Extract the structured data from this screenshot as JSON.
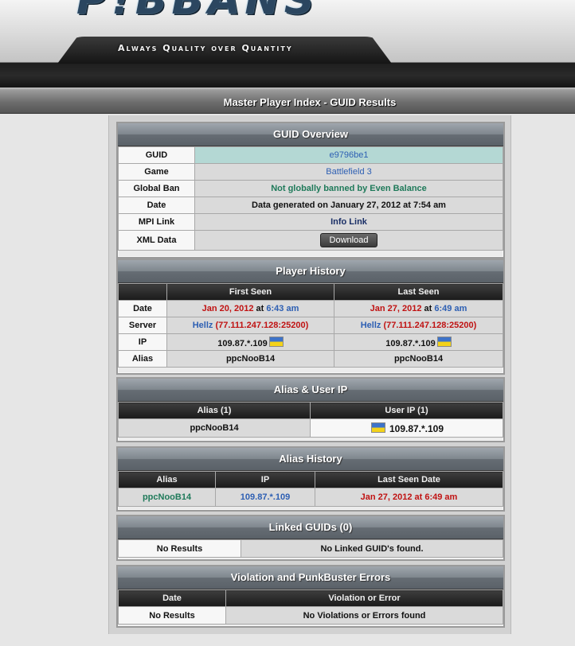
{
  "header": {
    "logo_text": "P!BBANS",
    "tagline": "Always Quality over Quantity"
  },
  "page_title": "Master Player Index - GUID Results",
  "guid_overview": {
    "title": "GUID Overview",
    "rows": {
      "guid": {
        "label": "GUID",
        "value": "e9796be1"
      },
      "game": {
        "label": "Game",
        "value": "Battlefield 3"
      },
      "global_ban": {
        "label": "Global Ban",
        "value": "Not globally banned by Even Balance"
      },
      "date": {
        "label": "Date",
        "value": "Data generated on January 27, 2012 at 7:54 am"
      },
      "mpi_link": {
        "label": "MPI Link",
        "value": "Info Link"
      },
      "xml_data": {
        "label": "XML Data",
        "value": "Download"
      }
    }
  },
  "player_history": {
    "title": "Player History",
    "headers": {
      "first_seen": "First Seen",
      "last_seen": "Last Seen"
    },
    "date": {
      "label": "Date",
      "first_date": "Jan 20, 2012",
      "first_time": "6:43 am",
      "last_date": "Jan 27, 2012",
      "last_time": "6:49 am",
      "at": "at"
    },
    "server": {
      "label": "Server",
      "first_name": "Hellz",
      "first_addr": "(77.111.247.128:25200)",
      "last_name": "Hellz",
      "last_addr": "(77.111.247.128:25200)"
    },
    "ip": {
      "label": "IP",
      "first": "109.87.*.109",
      "last": "109.87.*.109"
    },
    "alias": {
      "label": "Alias",
      "first": "ppcNooB14",
      "last": "ppcNooB14"
    }
  },
  "alias_user_ip": {
    "title": "Alias & User IP",
    "headers": {
      "alias": "Alias (1)",
      "user_ip": "User IP (1)"
    },
    "rows": [
      {
        "alias": "ppcNooB14",
        "ip": "109.87.*.109"
      }
    ]
  },
  "alias_history": {
    "title": "Alias History",
    "headers": {
      "alias": "Alias",
      "ip": "IP",
      "last_seen": "Last Seen Date"
    },
    "rows": [
      {
        "alias": "ppcNooB14",
        "ip": "109.87.*.109",
        "last_seen": "Jan 27, 2012 at 6:49 am"
      }
    ]
  },
  "linked_guids": {
    "title": "Linked GUIDs (0)",
    "left": "No Results",
    "right": "No Linked GUID's found."
  },
  "violations": {
    "title": "Violation and PunkBuster Errors",
    "headers": {
      "date": "Date",
      "violation": "Violation or Error"
    },
    "left": "No Results",
    "right": "No Violations or Errors found"
  },
  "colors": {
    "link_blue": "#2d5fb3",
    "date_red": "#c01212",
    "status_green": "#1f7a5a",
    "guid_bg": "#b4d8d4"
  },
  "icons": {
    "flag": "ukraine-flag-icon"
  }
}
